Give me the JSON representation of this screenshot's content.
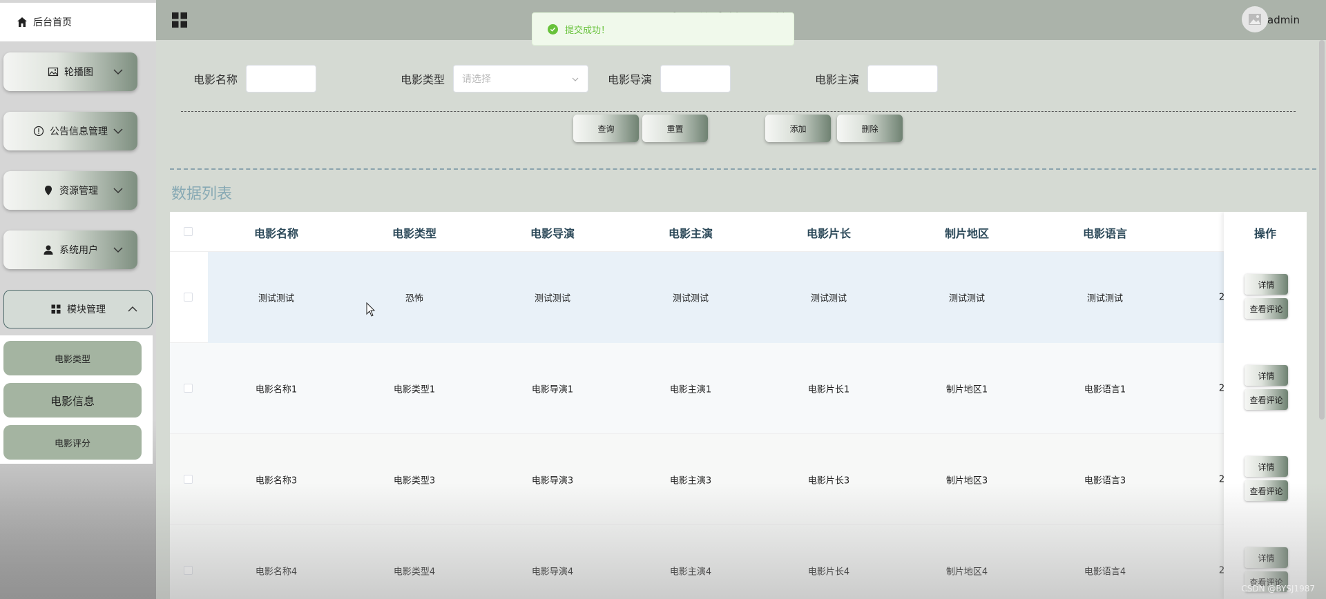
{
  "sidebar": {
    "home": "后台首页",
    "menus": [
      {
        "label": "轮播图",
        "icon": "image-icon"
      },
      {
        "label": "公告信息管理",
        "icon": "info-circle-icon"
      },
      {
        "label": "资源管理",
        "icon": "location-pin-icon"
      },
      {
        "label": "系统用户",
        "icon": "user-icon"
      },
      {
        "label": "模块管理",
        "icon": "grid-icon"
      }
    ],
    "submenu": [
      "电影类型",
      "电影信息",
      "电影评分"
    ]
  },
  "header": {
    "title": "电影信息管理系统",
    "username": "admin"
  },
  "toast": "提交成功！",
  "search": {
    "name_label": "电影名称",
    "type_label": "电影类型",
    "type_placeholder": "请选择",
    "director_label": "电影导演",
    "actor_label": "电影主演",
    "btn_query": "查询",
    "btn_reset": "重置",
    "btn_add": "添加",
    "btn_delete": "删除"
  },
  "list": {
    "title": "数据列表",
    "columns": [
      "电影名称",
      "电影类型",
      "电影导演",
      "电影主演",
      "电影片长",
      "制片地区",
      "电影语言"
    ],
    "ops_header": "操作",
    "rows": [
      [
        "测试测试",
        "恐怖",
        "测试测试",
        "测试测试",
        "测试测试",
        "测试测试",
        "测试测试",
        "2"
      ],
      [
        "电影名称1",
        "电影类型1",
        "电影导演1",
        "电影主演1",
        "电影片长1",
        "制片地区1",
        "电影语言1",
        "2"
      ],
      [
        "电影名称3",
        "电影类型3",
        "电影导演3",
        "电影主演3",
        "电影片长3",
        "制片地区3",
        "电影语言3",
        "2"
      ],
      [
        "电影名称4",
        "电影类型4",
        "电影导演4",
        "电影主演4",
        "电影片长4",
        "制片地区4",
        "电影语言4",
        "2"
      ]
    ],
    "op_detail": "详情",
    "op_comments": "查看评论"
  },
  "watermark": "CSDN @BYSJ1987"
}
